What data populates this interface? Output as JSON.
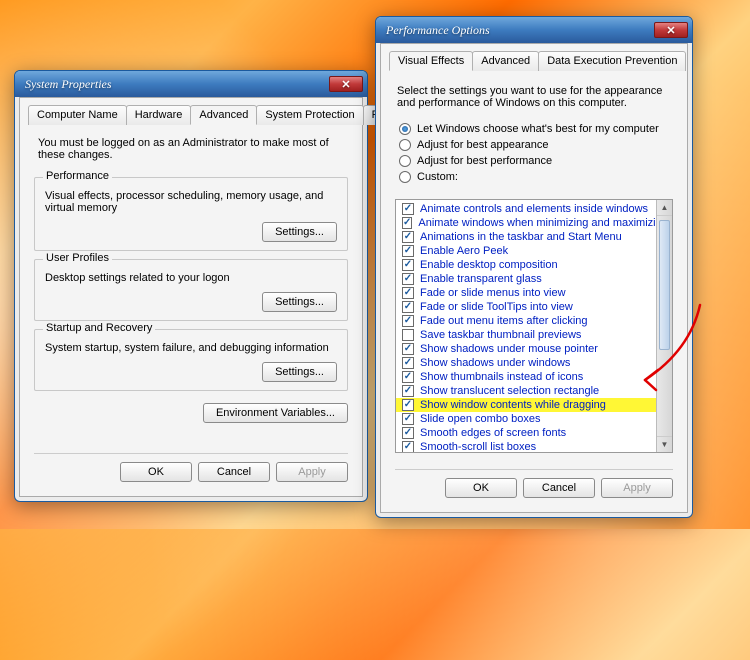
{
  "sp": {
    "title": "System Properties",
    "tabs": [
      "Computer Name",
      "Hardware",
      "Advanced",
      "System Protection",
      "Remote"
    ],
    "active_tab": 2,
    "note": "You must be logged on as an Administrator to make most of these changes.",
    "groups": {
      "performance": {
        "legend": "Performance",
        "desc": "Visual effects, processor scheduling, memory usage, and virtual memory",
        "button": "Settings..."
      },
      "profiles": {
        "legend": "User Profiles",
        "desc": "Desktop settings related to your logon",
        "button": "Settings..."
      },
      "startup": {
        "legend": "Startup and Recovery",
        "desc": "System startup, system failure, and debugging information",
        "button": "Settings..."
      }
    },
    "env_button": "Environment Variables...",
    "ok": "OK",
    "cancel": "Cancel",
    "apply": "Apply"
  },
  "po": {
    "title": "Performance Options",
    "tabs": [
      "Visual Effects",
      "Advanced",
      "Data Execution Prevention"
    ],
    "active_tab": 0,
    "instr": "Select the settings you want to use for the appearance and performance of Windows on this computer.",
    "radios": [
      {
        "label": "Let Windows choose what's best for my computer",
        "checked": true
      },
      {
        "label": "Adjust for best appearance",
        "checked": false
      },
      {
        "label": "Adjust for best performance",
        "checked": false
      },
      {
        "label": "Custom:",
        "checked": false
      }
    ],
    "items": [
      {
        "label": "Animate controls and elements inside windows",
        "checked": true
      },
      {
        "label": "Animate windows when minimizing and maximizing",
        "checked": true
      },
      {
        "label": "Animations in the taskbar and Start Menu",
        "checked": true
      },
      {
        "label": "Enable Aero Peek",
        "checked": true
      },
      {
        "label": "Enable desktop composition",
        "checked": true
      },
      {
        "label": "Enable transparent glass",
        "checked": true
      },
      {
        "label": "Fade or slide menus into view",
        "checked": true
      },
      {
        "label": "Fade or slide ToolTips into view",
        "checked": true
      },
      {
        "label": "Fade out menu items after clicking",
        "checked": true
      },
      {
        "label": "Save taskbar thumbnail previews",
        "checked": false
      },
      {
        "label": "Show shadows under mouse pointer",
        "checked": true
      },
      {
        "label": "Show shadows under windows",
        "checked": true
      },
      {
        "label": "Show thumbnails instead of icons",
        "checked": true
      },
      {
        "label": "Show translucent selection rectangle",
        "checked": true
      },
      {
        "label": "Show window contents while dragging",
        "checked": true,
        "highlight": true
      },
      {
        "label": "Slide open combo boxes",
        "checked": true
      },
      {
        "label": "Smooth edges of screen fonts",
        "checked": true
      },
      {
        "label": "Smooth-scroll list boxes",
        "checked": true
      }
    ],
    "ok": "OK",
    "cancel": "Cancel",
    "apply": "Apply"
  }
}
